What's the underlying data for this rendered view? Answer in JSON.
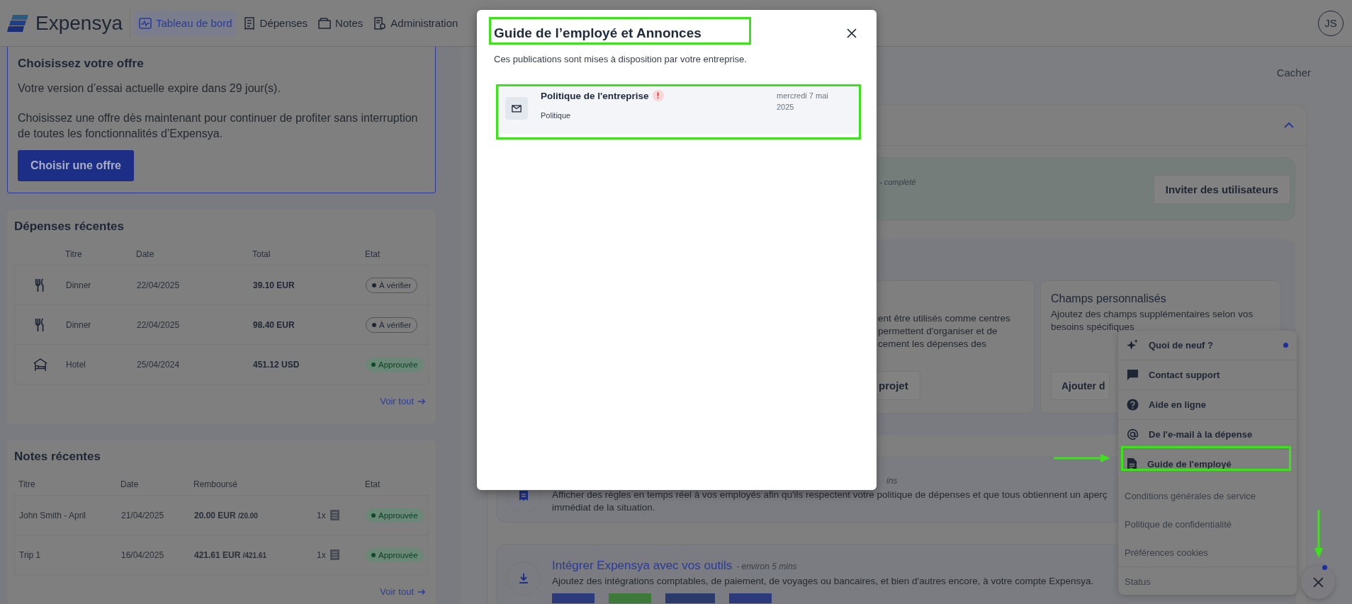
{
  "header": {
    "logo": "Expensya",
    "nav": [
      {
        "label": "Tableau de bord",
        "kind": "dashboard",
        "selected": true
      },
      {
        "label": "Dépenses",
        "kind": "expenses",
        "selected": false
      },
      {
        "label": "Notes",
        "kind": "notes",
        "selected": false
      },
      {
        "label": "Administration",
        "kind": "admin",
        "selected": false
      }
    ],
    "avatar": "JS"
  },
  "offer_card": {
    "title": "Choisissez votre offre",
    "lines": [
      "Votre version d’essai actuelle expire dans 29 jour(s).",
      "Choisissez une offre dès maintenant pour continuer de profiter sans interruption de toutes les fonctionnalités d’Expensya."
    ],
    "button": "Choisir une offre"
  },
  "recent_expenses": {
    "title": "Dépenses récentes",
    "columns": [
      "Titre",
      "Date",
      "Total",
      "Etat"
    ],
    "rows": [
      {
        "kind": "meal",
        "title": "Dinner",
        "date": "22/04/2025",
        "total": "39.10 EUR",
        "status": "À vérifier",
        "approved": false
      },
      {
        "kind": "meal",
        "title": "Dinner",
        "date": "22/04/2025",
        "total": "98.40 EUR",
        "status": "À vérifier",
        "approved": false
      },
      {
        "kind": "hotel",
        "title": "Hotel",
        "date": "25/04/2024",
        "total": "451.12 USD",
        "status": "Approuvée",
        "approved": true
      }
    ],
    "link": "Voir tout"
  },
  "recent_notes": {
    "title": "Notes récentes",
    "columns": [
      "Titre",
      "Date",
      "Remboursé",
      "Etat"
    ],
    "rows": [
      {
        "title": "John Smith - April",
        "date": "21/04/2025",
        "amount": "20.00 EUR",
        "amount_of": "/20.00",
        "receipts": "1x",
        "status": "Approuvée",
        "approved": true
      },
      {
        "title": "Trip 1",
        "date": "16/04/2025",
        "amount": "421.61 EUR",
        "amount_of": "/421.61",
        "receipts": "1x",
        "status": "Approuvée",
        "approved": true
      }
    ],
    "link": "Voir tout"
  },
  "onboarding": {
    "hide": "Cacher",
    "expanded": true,
    "invite": {
      "note": "- completé",
      "button": "Inviter des utilisateurs"
    },
    "cards": [
      {
        "lines": [
          "ent être utilisés comme centres",
          "permettent d'organiser et de",
          "cement les dépenses des"
        ],
        "button": "projet"
      },
      {
        "title": "Champs personnalisés",
        "lines": [
          "Ajoutez des champs supplémentaires selon vos",
          "besoins spécifiques"
        ],
        "button": "Ajouter d"
      }
    ],
    "tasks": [
      {
        "kind": "rules",
        "duration": "ins",
        "lines": [
          "Afficher des règles en temps réel à vos employés afin qu'ils respectent votre politique de dépenses et que tous obtiennent un aperç",
          "immédiat de la situation."
        ]
      },
      {
        "kind": "integrate",
        "title": "Intégrer Expensya avec vos outils",
        "duration": "- environ 5 mins",
        "lines": [
          "Ajoutez des intégrations comptables, de paiement, de voyages ou bancaires, et bien d'autres encore, à votre compte Expensya."
        ]
      }
    ]
  },
  "modal": {
    "title": "Guide de l’employé et Annonces",
    "subtitle": "Ces publications sont mises à disposition par votre entreprise.",
    "items": [
      {
        "title": "Politique de l'entreprise",
        "unread": true,
        "category": "Politique",
        "date": "mercredi 7 mai 2025"
      }
    ]
  },
  "help_menu": {
    "items": [
      {
        "label": "Quoi de neuf ?",
        "kind": "news",
        "unread": true
      },
      {
        "label": "Contact support",
        "kind": "support",
        "unread": false
      },
      {
        "label": "Aide en ligne",
        "kind": "help",
        "unread": false
      },
      {
        "label": "De l'e-mail à la dépense",
        "kind": "email",
        "unread": false
      },
      {
        "label": "Guide de l'employé",
        "kind": "guide",
        "unread": false
      },
      {
        "label": "Conditions générales de service",
        "kind": "legal",
        "unread": false
      },
      {
        "label": "Politique de confidentialité",
        "kind": "legal",
        "unread": false
      },
      {
        "label": "Préférences cookies",
        "kind": "legal",
        "unread": false
      },
      {
        "label": "Status",
        "kind": "status",
        "unread": false
      }
    ]
  },
  "fab": {
    "unread": true
  }
}
